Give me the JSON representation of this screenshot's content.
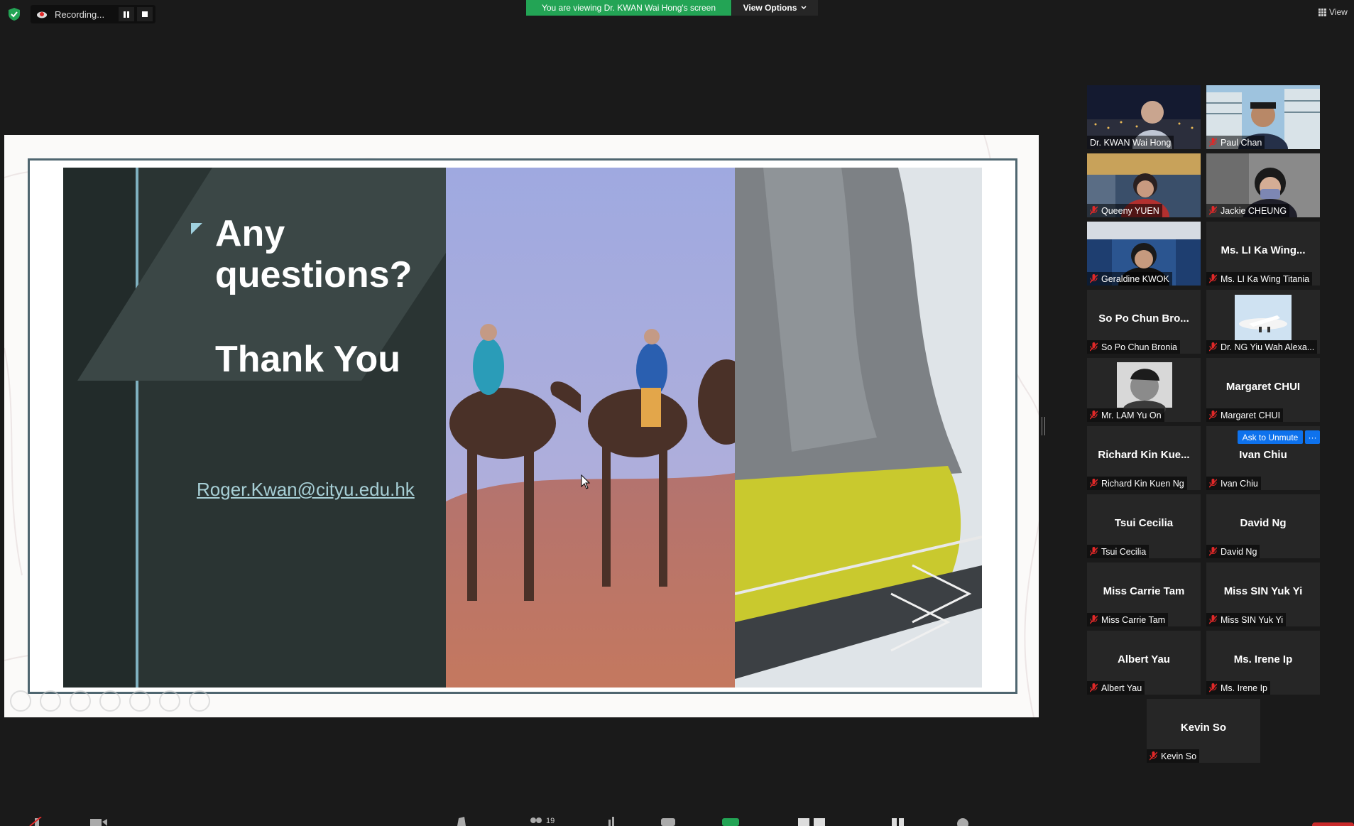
{
  "recording": {
    "label": "Recording..."
  },
  "banner": {
    "viewing": "You are viewing Dr. KWAN Wai Hong's screen",
    "view_options": "View Options",
    "view": "View"
  },
  "slide": {
    "line1": "Any",
    "line2": "questions?",
    "thanks": "Thank You",
    "email": "Roger.Kwan@cityu.edu.hk"
  },
  "participants": [
    {
      "display": "",
      "caption": "Dr. KWAN Wai Hong",
      "video": true,
      "muted": false,
      "active": true
    },
    {
      "display": "",
      "caption": "Paul Chan",
      "video": true,
      "muted": true
    },
    {
      "display": "",
      "caption": "Queeny YUEN",
      "video": true,
      "muted": true
    },
    {
      "display": "",
      "caption": "Jackie CHEUNG",
      "video": true,
      "muted": true
    },
    {
      "display": "",
      "caption": "Geraldine KWOK",
      "video": true,
      "muted": true
    },
    {
      "display": "Ms. LI Ka Wing...",
      "caption": "Ms. LI Ka Wing Titania",
      "video": false,
      "muted": true
    },
    {
      "display": "So Po Chun Bro...",
      "caption": "So Po Chun Bronia",
      "video": false,
      "muted": true
    },
    {
      "display": "",
      "caption": "Dr. NG Yiu Wah Alexa...",
      "video": true,
      "muted": true
    },
    {
      "display": "",
      "caption": "Mr. LAM Yu On",
      "video": true,
      "muted": true
    },
    {
      "display": "Margaret CHUI",
      "caption": "Margaret CHUI",
      "video": false,
      "muted": true
    },
    {
      "display": "Richard Kin Kue...",
      "caption": "Richard Kin Kuen Ng",
      "video": false,
      "muted": true
    },
    {
      "display": "Ivan Chiu",
      "caption": "Ivan Chiu",
      "video": false,
      "muted": true
    },
    {
      "display": "Tsui Cecilia",
      "caption": "Tsui Cecilia",
      "video": false,
      "muted": true
    },
    {
      "display": "David Ng",
      "caption": "David Ng",
      "video": false,
      "muted": true
    },
    {
      "display": "Miss Carrie Tam",
      "caption": "Miss Carrie Tam",
      "video": false,
      "muted": true
    },
    {
      "display": "Miss SIN Yuk Yi",
      "caption": "Miss SIN Yuk Yi",
      "video": false,
      "muted": true
    },
    {
      "display": "Albert Yau",
      "caption": "Albert Yau",
      "video": false,
      "muted": true
    },
    {
      "display": "Ms. Irene Ip",
      "caption": "Ms. Irene Ip",
      "video": false,
      "muted": true
    },
    {
      "display": "Kevin So",
      "caption": "Kevin So",
      "video": false,
      "muted": true
    }
  ],
  "hover": {
    "ask_to_unmute": "Ask to Unmute",
    "more": "···"
  },
  "toolbar": {
    "participants_count": "19"
  }
}
